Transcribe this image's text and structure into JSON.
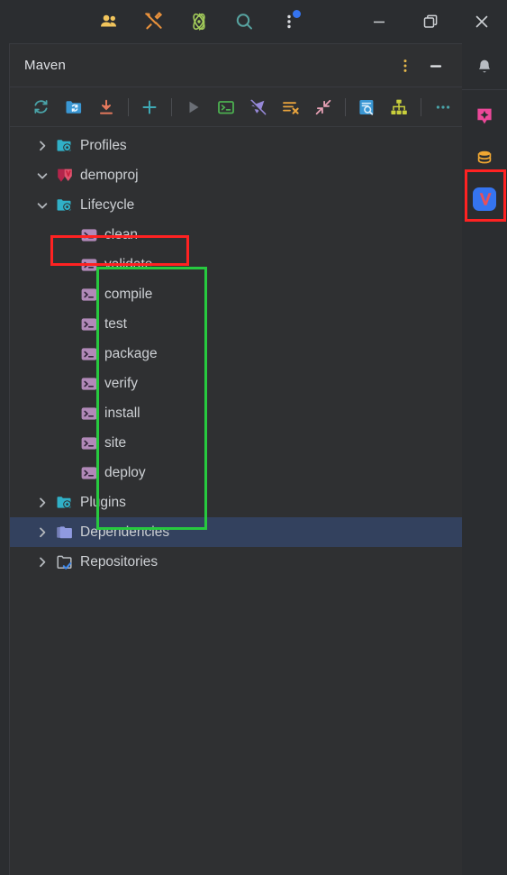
{
  "window": {
    "toolbar_icons": [
      {
        "name": "people-icon",
        "label": "Collaborate"
      },
      {
        "name": "tools-icon",
        "label": "Tools"
      },
      {
        "name": "atom-icon",
        "label": "Atom"
      },
      {
        "name": "search-icon",
        "label": "Search"
      },
      {
        "name": "more-vertical-icon",
        "label": "More",
        "badge": true
      }
    ],
    "controls": [
      {
        "name": "minimize-window-button",
        "label": "Minimize"
      },
      {
        "name": "restore-window-button",
        "label": "Restore"
      },
      {
        "name": "close-window-button",
        "label": "Close"
      }
    ]
  },
  "panel": {
    "title": "Maven",
    "options_label": "Options",
    "hide_label": "Hide",
    "toolbar": [
      {
        "name": "reload-project-button",
        "label": "Reload All Maven Projects"
      },
      {
        "name": "add-maven-project-button",
        "label": "Add Maven Project"
      },
      {
        "name": "download-sources-button",
        "label": "Download Sources and Documentation"
      },
      {
        "name": "add-plugin-button",
        "label": "Add"
      },
      {
        "name": "run-build-button",
        "label": "Run Build"
      },
      {
        "name": "execute-maven-goal-button",
        "label": "Execute Maven Goal"
      },
      {
        "name": "toggle-skip-tests-button",
        "label": "Toggle Skip Tests Mode"
      },
      {
        "name": "toggle-offline-button",
        "label": "Toggle Offline Mode"
      },
      {
        "name": "collapse-all-button",
        "label": "Collapse All"
      },
      {
        "name": "show-dependency-analyzer-button",
        "label": "Analyze Dependencies"
      },
      {
        "name": "show-diagram-button",
        "label": "Show Diagram"
      },
      {
        "name": "more-options-button",
        "label": "More Options"
      }
    ]
  },
  "tree": {
    "nodes": [
      {
        "name": "tree-node-profiles",
        "label": "Profiles",
        "icon": "folder-gear-icon",
        "arrow": "chevron-right",
        "depth": 1,
        "selected": false
      },
      {
        "name": "tree-node-demoproj",
        "label": "demoproj",
        "icon": "maven-project-icon",
        "arrow": "chevron-down",
        "depth": 1,
        "selected": false
      },
      {
        "name": "tree-node-lifecycle",
        "label": "Lifecycle",
        "icon": "folder-gear-icon",
        "arrow": "chevron-down",
        "depth": 2,
        "selected": false
      },
      {
        "name": "tree-node-phase-clean",
        "label": "clean",
        "icon": "terminal-icon",
        "arrow": "none",
        "depth": 3,
        "selected": false
      },
      {
        "name": "tree-node-phase-validate",
        "label": "validate",
        "icon": "terminal-icon",
        "arrow": "none",
        "depth": 3,
        "selected": false
      },
      {
        "name": "tree-node-phase-compile",
        "label": "compile",
        "icon": "terminal-icon",
        "arrow": "none",
        "depth": 3,
        "selected": false
      },
      {
        "name": "tree-node-phase-test",
        "label": "test",
        "icon": "terminal-icon",
        "arrow": "none",
        "depth": 3,
        "selected": false
      },
      {
        "name": "tree-node-phase-package",
        "label": "package",
        "icon": "terminal-icon",
        "arrow": "none",
        "depth": 3,
        "selected": false
      },
      {
        "name": "tree-node-phase-verify",
        "label": "verify",
        "icon": "terminal-icon",
        "arrow": "none",
        "depth": 3,
        "selected": false
      },
      {
        "name": "tree-node-phase-install",
        "label": "install",
        "icon": "terminal-icon",
        "arrow": "none",
        "depth": 3,
        "selected": false
      },
      {
        "name": "tree-node-phase-site",
        "label": "site",
        "icon": "terminal-icon",
        "arrow": "none",
        "depth": 3,
        "selected": false
      },
      {
        "name": "tree-node-phase-deploy",
        "label": "deploy",
        "icon": "terminal-icon",
        "arrow": "none",
        "depth": 3,
        "selected": false
      },
      {
        "name": "tree-node-plugins",
        "label": "Plugins",
        "icon": "folder-gear-icon",
        "arrow": "chevron-right",
        "depth": 2,
        "selected": false
      },
      {
        "name": "tree-node-dependencies",
        "label": "Dependencies",
        "icon": "folder-stack-icon",
        "arrow": "chevron-right",
        "depth": 2,
        "selected": true
      },
      {
        "name": "tree-node-repositories",
        "label": "Repositories",
        "icon": "folder-check-icon",
        "arrow": "chevron-right",
        "depth": 2,
        "selected": false
      }
    ]
  },
  "annotations": [
    {
      "name": "highlight-box-lifecycle",
      "color": "#ff2222",
      "target": "Lifecycle"
    },
    {
      "name": "highlight-box-lifecycle-phases",
      "color": "#27c93f",
      "target": "lifecycle phases"
    },
    {
      "name": "highlight-box-maven-tool-window-icon",
      "color": "#ff2222",
      "target": "Maven tool window button"
    }
  ],
  "rail": {
    "items": [
      {
        "name": "notifications-button",
        "label": "Notifications",
        "icon": "bell-icon",
        "color": "#b8bcc2"
      },
      {
        "name": "ai-assistant-button",
        "label": "AI Assistant",
        "icon": "ai-spark-icon",
        "color": "#ec4899"
      },
      {
        "name": "database-button",
        "label": "Database",
        "icon": "database-icon",
        "color": "#f0a732"
      },
      {
        "name": "maven-tool-window-button",
        "label": "Maven",
        "icon": "maven-icon",
        "color": "#3574f0",
        "active": true
      }
    ]
  },
  "colors": {
    "background": "#2f3032",
    "chrome": "#2b2d30",
    "selection": "#33415e",
    "text": "#cdd0d4",
    "border": "#393b40",
    "accent_red": "#ff2222",
    "accent_green": "#27c93f"
  }
}
